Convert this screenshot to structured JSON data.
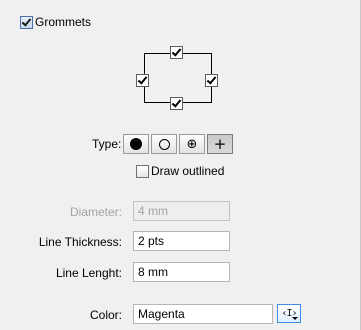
{
  "grommets": {
    "label": "Grommets",
    "checked": true
  },
  "diagram": {
    "top_checked": true,
    "left_checked": true,
    "right_checked": true,
    "bottom_checked": true
  },
  "type": {
    "label": "Type:",
    "options": [
      {
        "name": "filled-circle",
        "glyph": ""
      },
      {
        "name": "open-circle",
        "glyph": ""
      },
      {
        "name": "crosshair-circle",
        "glyph": "⊕"
      },
      {
        "name": "plus",
        "glyph": "+"
      }
    ],
    "selected": "plus"
  },
  "draw_outlined": {
    "label": "Draw outlined",
    "checked": false
  },
  "diameter": {
    "label": "Diameter:",
    "value": "4 mm",
    "enabled": false
  },
  "line_thickness": {
    "label": "Line Thickness:",
    "value": "2 pts"
  },
  "line_length": {
    "label": "Line Lenght:",
    "value": "8 mm"
  },
  "color": {
    "label": "Color:",
    "value": "Magenta",
    "picker_glyph": "‹I›"
  }
}
